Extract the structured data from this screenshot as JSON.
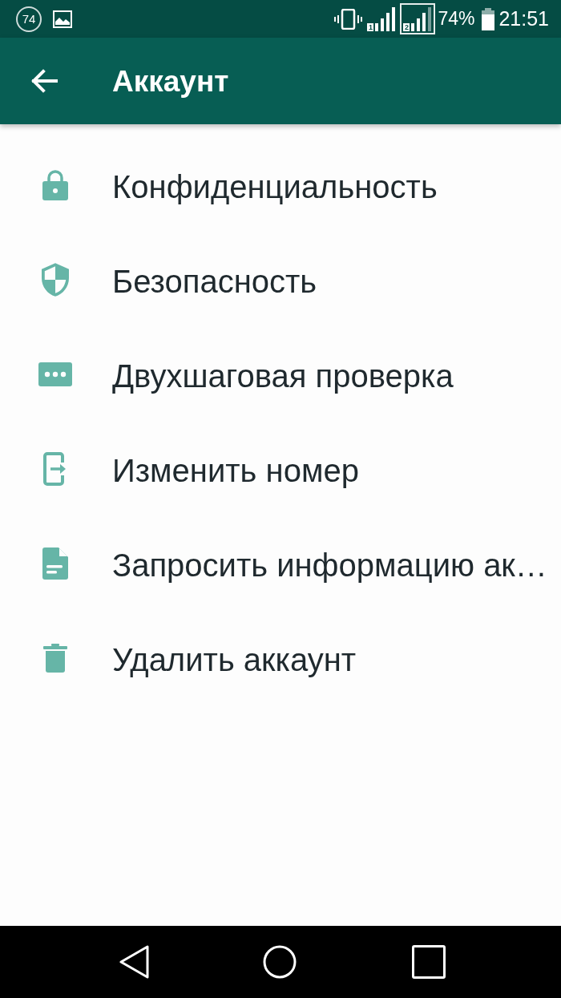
{
  "status_bar": {
    "notification_count": "74",
    "sims": [
      {
        "number": "1",
        "selected": false
      },
      {
        "number": "2",
        "selected": true
      }
    ],
    "battery": "74%",
    "time": "21:51"
  },
  "app_bar": {
    "title": "Аккаунт"
  },
  "items": [
    {
      "label": "Конфиденциальность"
    },
    {
      "label": "Безопасность"
    },
    {
      "label": "Двухшаговая проверка"
    },
    {
      "label": "Изменить номер"
    },
    {
      "label": "Запросить информацию ак…"
    },
    {
      "label": "Удалить аккаунт"
    }
  ]
}
